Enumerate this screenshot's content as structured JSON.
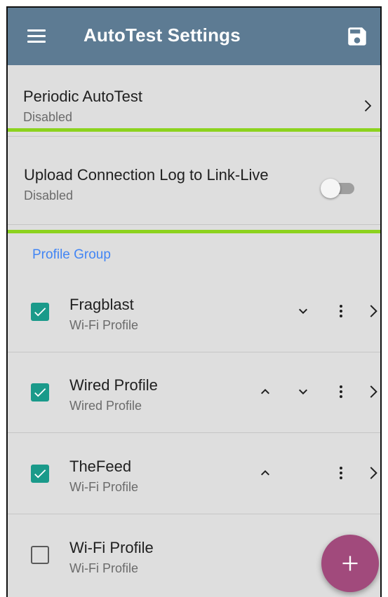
{
  "app_bar": {
    "title": "AutoTest Settings",
    "background": "#5d7b93",
    "menu_icon": "menu-icon",
    "save_icon": "save-icon"
  },
  "periodic_autotest": {
    "title": "Periodic AutoTest",
    "status": "Disabled"
  },
  "upload_log": {
    "title": "Upload Connection Log to Link-Live",
    "status": "Disabled",
    "toggle_on": false,
    "highlight_color": "#8cd21e"
  },
  "profile_group": {
    "header": "Profile Group",
    "header_color": "#4285f4",
    "profiles": [
      {
        "name": "Fragblast",
        "type": "Wi-Fi Profile",
        "checked": true
      },
      {
        "name": "Wired Profile",
        "type": "Wired Profile",
        "checked": true
      },
      {
        "name": "TheFeed",
        "type": "Wi-Fi Profile",
        "checked": true
      },
      {
        "name": "Wi-Fi Profile",
        "type": "Wi-Fi Profile",
        "checked": false
      }
    ]
  },
  "fab": {
    "icon": "plus-icon",
    "color": "#a14a7c"
  },
  "checkbox_color": "#1a9a8a"
}
